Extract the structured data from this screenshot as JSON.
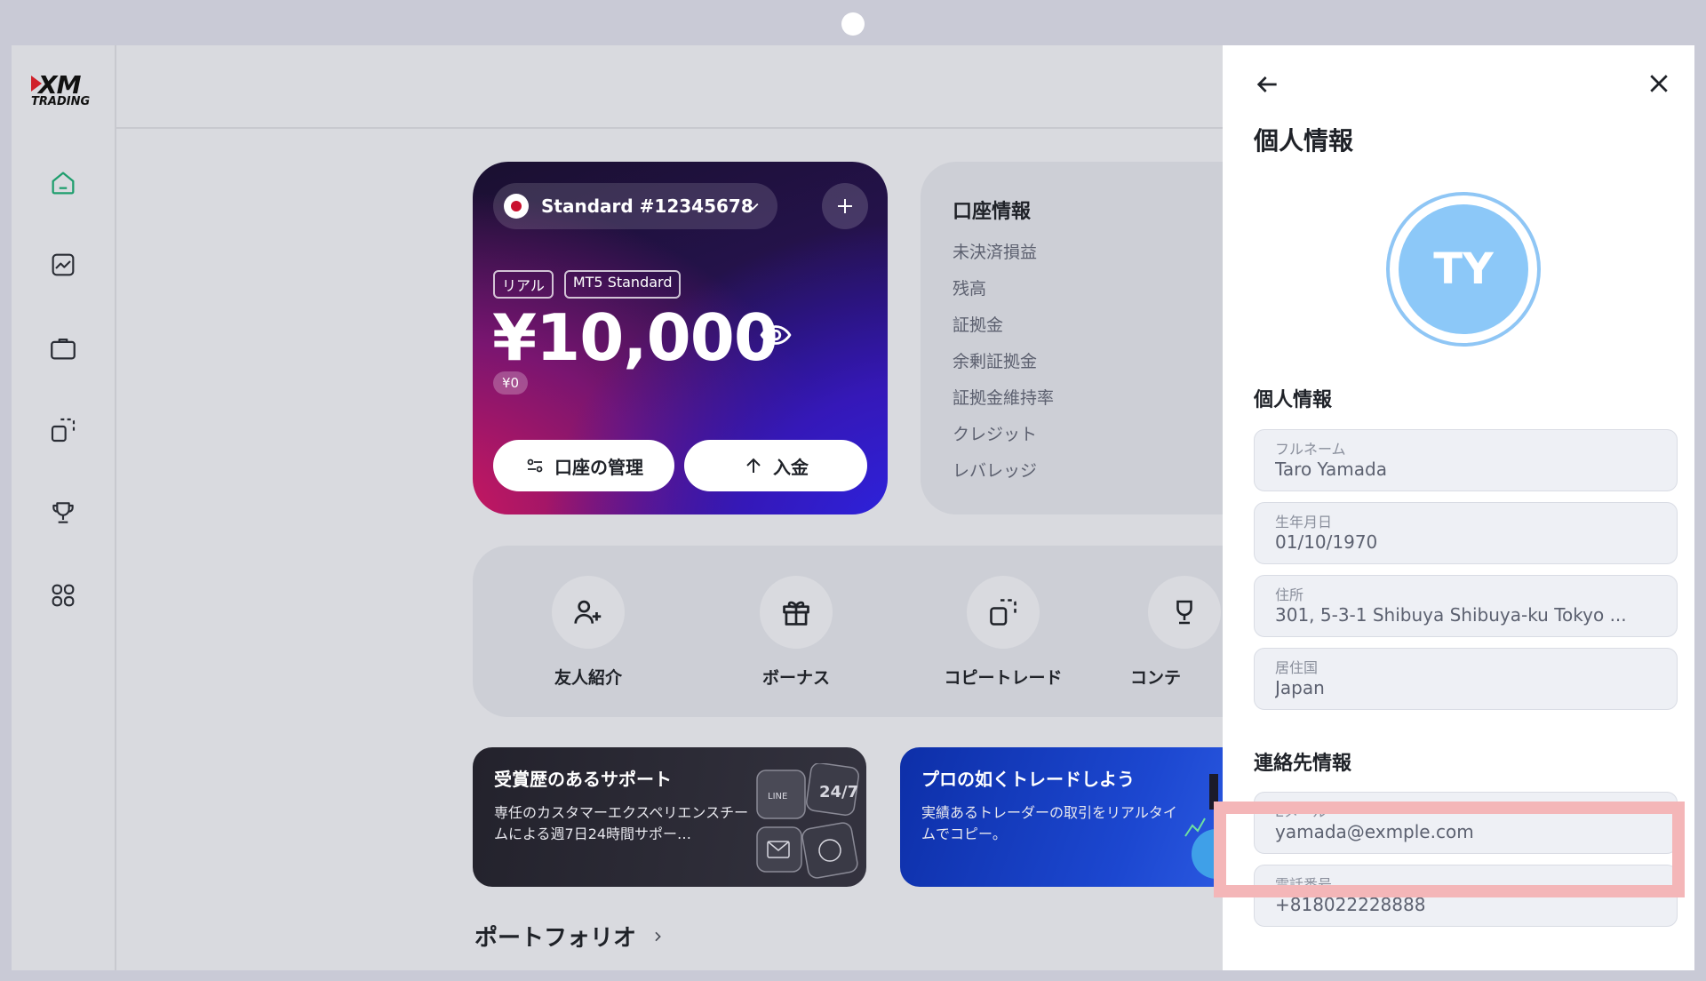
{
  "sidebar": {
    "logo_text": "XM",
    "logo_sub": "TRADING",
    "items": [
      {
        "icon": "home-icon",
        "active": true
      },
      {
        "icon": "chart-icon"
      },
      {
        "icon": "briefcase-icon"
      },
      {
        "icon": "copy-trade-icon"
      },
      {
        "icon": "trophy-icon"
      },
      {
        "icon": "apps-grid-icon"
      }
    ]
  },
  "account_card": {
    "account_label": "Standard #12345678",
    "tags": [
      "リアル",
      "MT5 Standard"
    ],
    "balance": "¥10,000",
    "credit": "¥0",
    "manage_label": "口座の管理",
    "deposit_label": "入金",
    "accent_colors": [
      "#d1185e",
      "#2a25e8"
    ]
  },
  "account_info": {
    "title": "口座情報",
    "items": [
      "未決済損益",
      "残高",
      "証拠金",
      "余剰証拠金",
      "証拠金維持率",
      "クレジット",
      "レバレッジ"
    ]
  },
  "quick_actions": [
    {
      "label": "友人紹介",
      "icon": "add-user-icon"
    },
    {
      "label": "ボーナス",
      "icon": "gift-icon"
    },
    {
      "label": "コピートレード",
      "icon": "copy-trade-icon"
    },
    {
      "label": "コンテ",
      "icon": "trophy-icon"
    }
  ],
  "promos": [
    {
      "title": "受賞歴のあるサポート",
      "text": "専任のカスタマーエクスペリエンスチームによる週7日24時間サポー…",
      "badge": "24/7",
      "badge_sub": "LINE"
    },
    {
      "title": "プロの如くトレードしよう",
      "text": "実績あるトレーダーの取引をリアルタイムでコピー。"
    }
  ],
  "portfolio_label": "ポートフォリオ",
  "panel": {
    "title": "個人情報",
    "avatar_initials": "TY",
    "personal_heading": "個人情報",
    "personal_fields": [
      {
        "label": "フルネーム",
        "value": "Taro Yamada"
      },
      {
        "label": "生年月日",
        "value": "01/10/1970"
      },
      {
        "label": "住所",
        "value": "301, 5-3-1 Shibuya Shibuya-ku Tokyo ..."
      },
      {
        "label": "居住国",
        "value": "Japan"
      }
    ],
    "contact_heading": "連絡先情報",
    "contact_fields": [
      {
        "label": "Eメール",
        "value": "yamada@exmple.com"
      },
      {
        "label": "電話番号",
        "value": "+818022228888"
      }
    ],
    "highlight_color": "#f4b6b8"
  }
}
